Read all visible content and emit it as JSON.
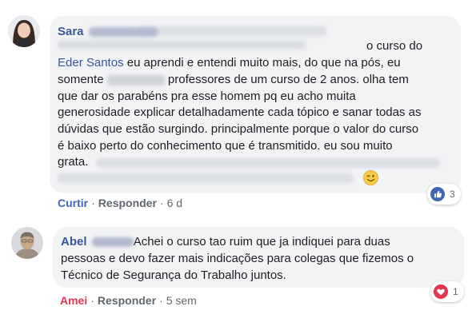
{
  "comments": [
    {
      "author_visible": "Sara",
      "author_hidden": "Rib Ribeiro",
      "text_top_faded": "ajuda do grupo pq eu ja estou mais segura pois com",
      "text_top_faded_2": "ajuda do grupo pra eu me sentir mais segura pois com",
      "text_1": "o curso do",
      "link": "Eder Santos",
      "text_2": "eu aprendi e entendi muito mais, do que na pós, eu",
      "text_3a": "somente",
      "text_3b": "professores de um curso de 2 anos. olha tem",
      "text_4": "que dar os parabéns pra esse homem pq eu acho muita",
      "text_5": "generosidade explicar detalhadamente cada tópico e sanar todas as",
      "text_6": "dúvidas que estão surgindo. principalmente porque o valor do curso",
      "text_7": "é baixo perto do conhecimento que é transmitido. eu sou muito",
      "text_8": "grata.",
      "emoji_icon": "winking-face-icon",
      "actions": {
        "react": "Curtir",
        "reply": "Responder",
        "time": "6 d",
        "sep": "·"
      },
      "reaction": {
        "icon": "like-icon",
        "count": "3",
        "color": "#4267b2"
      }
    },
    {
      "author_visible": "Abel",
      "author_hidden": "Ribeiro",
      "text_1": "Achei o curso tao ruim que ja indiquei para duas",
      "text_2": "pessoas e devo fazer mais indicações para colegas que fizemos o",
      "text_3": "Técnico de Segurança do Trabalho juntos.",
      "actions": {
        "react": "Amei",
        "reply": "Responder",
        "time": "5 sem",
        "sep": "·"
      },
      "reaction": {
        "icon": "love-icon",
        "count": "1",
        "color": "#e5344e"
      }
    }
  ],
  "colors": {
    "link": "#385898",
    "bubble": "#f2f3f5",
    "meta": "#606770",
    "like": "#4267b2",
    "love": "#e5344e"
  }
}
